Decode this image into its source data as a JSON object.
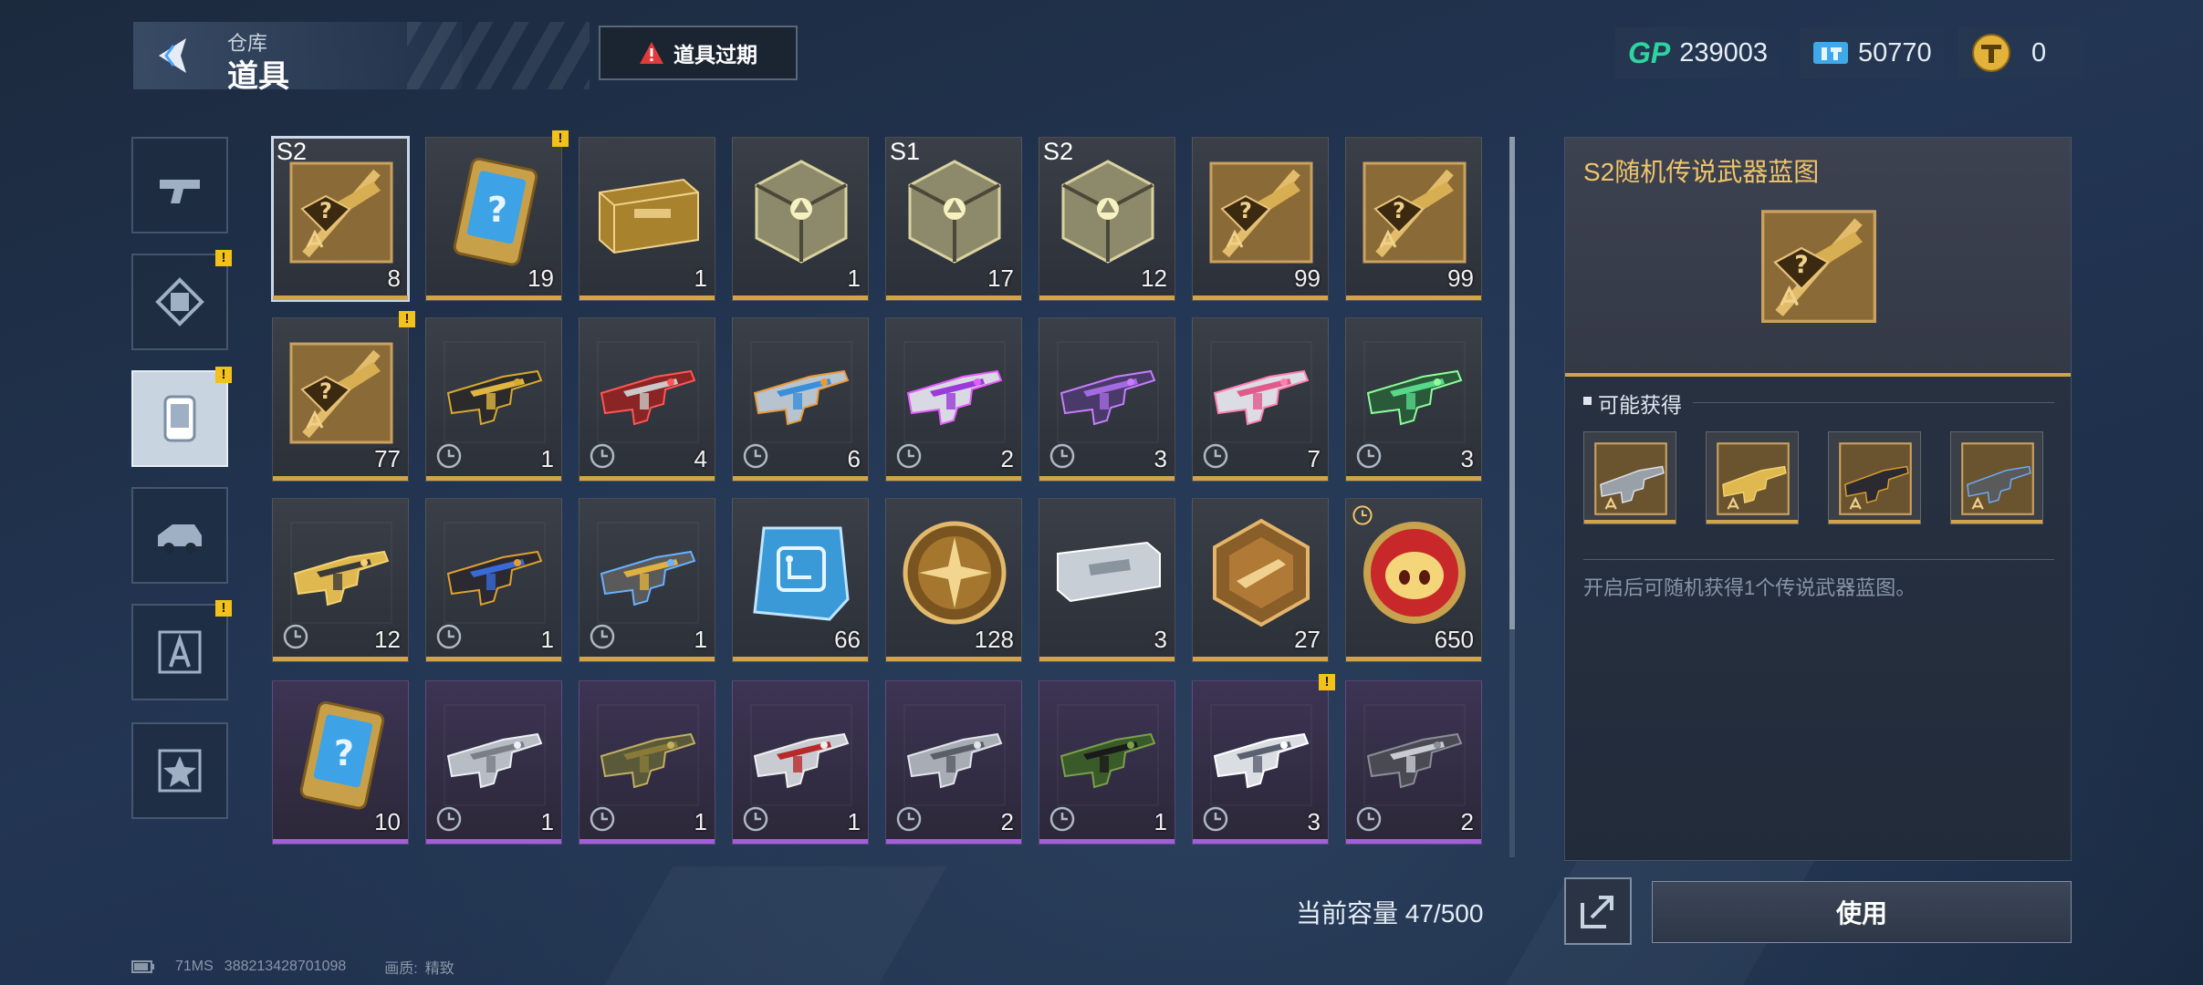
{
  "header": {
    "subtitle": "仓库",
    "title": "道具",
    "expire_button": "道具过期"
  },
  "currencies": [
    {
      "icon": "gp-icon",
      "label": "GP",
      "value": "239003"
    },
    {
      "icon": "ticket-icon",
      "value": "50770"
    },
    {
      "icon": "gold-coin-icon",
      "value": "0"
    }
  ],
  "tabs": [
    {
      "name": "tab-weapons",
      "icon": "pistol-icon",
      "badge": false,
      "active": false
    },
    {
      "name": "tab-outfits",
      "icon": "frame-icon",
      "badge": true,
      "badge_text": "!",
      "active": false
    },
    {
      "name": "tab-items",
      "icon": "item-card-icon",
      "badge": true,
      "badge_text": "!",
      "active": true
    },
    {
      "name": "tab-vehicles",
      "icon": "vehicle-icon",
      "badge": false,
      "active": false
    },
    {
      "name": "tab-blueprints",
      "icon": "blueprint-icon",
      "badge": true,
      "badge_text": "!",
      "active": false
    },
    {
      "name": "tab-favorites",
      "icon": "star-icon",
      "badge": false,
      "active": false
    }
  ],
  "items": [
    {
      "icon": "legendary-blueprint-icon",
      "season": "S2",
      "qty": "8",
      "rarity": "gold",
      "selected": true
    },
    {
      "icon": "mystery-card-icon",
      "qty": "19",
      "rarity": "gold",
      "badge": "!"
    },
    {
      "icon": "supply-crate-icon",
      "qty": "1",
      "rarity": "gold"
    },
    {
      "icon": "cube-crate-icon",
      "qty": "1",
      "rarity": "gold"
    },
    {
      "icon": "cube-crate-icon",
      "season": "S1",
      "qty": "17",
      "rarity": "gold"
    },
    {
      "icon": "cube-crate-icon",
      "season": "S2",
      "qty": "12",
      "rarity": "gold"
    },
    {
      "icon": "legendary-blueprint-icon",
      "qty": "99",
      "rarity": "gold"
    },
    {
      "icon": "legendary-blueprint-icon",
      "qty": "99",
      "rarity": "gold"
    },
    {
      "icon": "legendary-blueprint-icon",
      "qty": "77",
      "rarity": "gold",
      "badge": "!"
    },
    {
      "icon": "rifle-gold-black-icon",
      "qty": "1",
      "rarity": "gold",
      "timed": true
    },
    {
      "icon": "rifle-red-icon",
      "qty": "4",
      "rarity": "gold",
      "timed": true
    },
    {
      "icon": "blaster-blue-icon",
      "qty": "6",
      "rarity": "gold",
      "timed": true
    },
    {
      "icon": "rifle-purple-icon",
      "qty": "2",
      "rarity": "gold",
      "timed": true
    },
    {
      "icon": "rifle-violet-icon",
      "qty": "3",
      "rarity": "gold",
      "timed": true
    },
    {
      "icon": "rifle-pink-icon",
      "qty": "7",
      "rarity": "gold",
      "timed": true
    },
    {
      "icon": "rifle-green-icon",
      "qty": "3",
      "rarity": "gold",
      "timed": true
    },
    {
      "icon": "shotgun-gold-icon",
      "qty": "12",
      "rarity": "gold",
      "timed": true
    },
    {
      "icon": "smg-blue-icon",
      "qty": "1",
      "rarity": "gold",
      "timed": true
    },
    {
      "icon": "pistol-gold-icon",
      "qty": "1",
      "rarity": "gold",
      "timed": true
    },
    {
      "icon": "circuit-chip-icon",
      "qty": "66",
      "rarity": "gold"
    },
    {
      "icon": "bronze-cross-coin-icon",
      "qty": "128",
      "rarity": "gold"
    },
    {
      "icon": "silver-ticket-icon",
      "qty": "3",
      "rarity": "gold"
    },
    {
      "icon": "hex-medal-icon",
      "qty": "27",
      "rarity": "gold"
    },
    {
      "icon": "pig-token-icon",
      "qty": "650",
      "rarity": "gold",
      "clock_top": true
    },
    {
      "icon": "mystery-card-icon",
      "qty": "10",
      "rarity": "purple"
    },
    {
      "icon": "shotgun-silver-icon",
      "qty": "1",
      "rarity": "purple",
      "timed": true
    },
    {
      "icon": "rifle-camo-icon",
      "qty": "1",
      "rarity": "purple",
      "timed": true
    },
    {
      "icon": "rifle-red-silver-icon",
      "qty": "1",
      "rarity": "purple",
      "timed": true
    },
    {
      "icon": "smg-silver-icon",
      "qty": "2",
      "rarity": "purple",
      "timed": true
    },
    {
      "icon": "launcher-green-icon",
      "qty": "1",
      "rarity": "purple",
      "timed": true
    },
    {
      "icon": "rifle-white-icon",
      "qty": "3",
      "rarity": "purple",
      "timed": true,
      "badge": "!"
    },
    {
      "icon": "crossbow-icon",
      "qty": "2",
      "rarity": "purple",
      "timed": true
    }
  ],
  "capacity": "当前容量 47/500",
  "detail": {
    "title": "S2随机传说武器蓝图",
    "icon": "legendary-blueprint-icon",
    "possible_label": "可能获得",
    "rewards": [
      {
        "icon": "knife-blueprint-icon"
      },
      {
        "icon": "rifle-blueprint-icon"
      },
      {
        "icon": "smg-blueprint-icon"
      },
      {
        "icon": "pistol-blueprint-icon"
      }
    ],
    "description": "开启后可随机获得1个传说武器蓝图。"
  },
  "actions": {
    "share_icon": "share-icon",
    "use_label": "使用"
  },
  "status_bar": {
    "ping": "71MS",
    "uid": "388213428701098",
    "quality_label": "画质:",
    "quality_value": "精致"
  },
  "colors": {
    "gold_rarity": "#d2a44a",
    "purple_rarity": "#a15fdc",
    "warning": "#f3c21a",
    "gp_green": "#2fd3a0",
    "title_gold": "#f0c56a"
  }
}
